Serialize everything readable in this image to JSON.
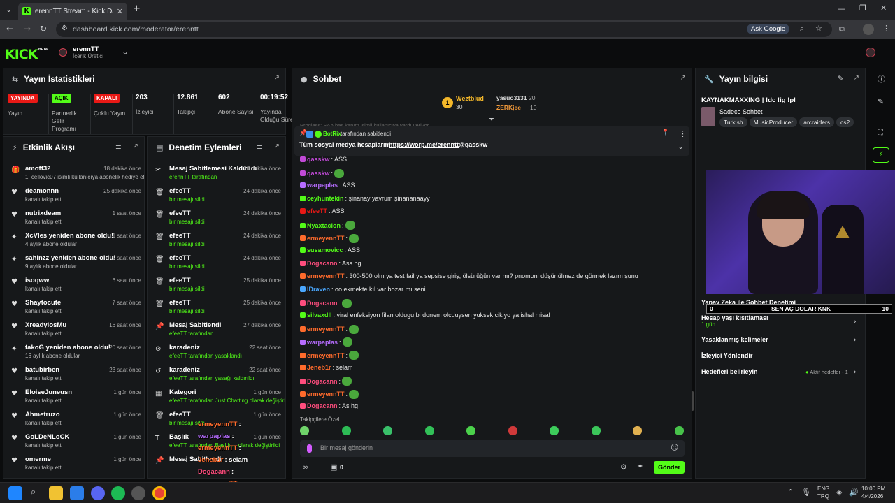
{
  "browser": {
    "tab_title": "erennTT Stream - Kick Dashboa",
    "url": "dashboard.kick.com/moderator/erenntt",
    "ask_google": "Ask Google"
  },
  "header": {
    "logo": "KICK",
    "beta": "BETA",
    "channel": "erennTT",
    "role": "İçerik Üretici"
  },
  "stats": {
    "title": "Yayın İstatistikleri",
    "items": [
      {
        "badge": "YAYINDA",
        "badge_color": "#e91916",
        "label": "Yayın"
      },
      {
        "badge": "AÇIK",
        "badge_color": "#53fc18",
        "label": "Partnerlik Gelir Programı"
      },
      {
        "badge": "KAPALI",
        "badge_color": "#e91916",
        "label": "Çoklu Yayın"
      },
      {
        "value": "203",
        "label": "İzleyici"
      },
      {
        "value": "12.861",
        "label": "Takipçi"
      },
      {
        "value": "602",
        "label": "Abone Sayısı"
      },
      {
        "value": "00:19:52",
        "label": "Yayında Olduğu Süre"
      }
    ]
  },
  "activity": {
    "title": "Etkinlik Akışı",
    "items": [
      {
        "icon": "gift-icon",
        "name": "amoff32",
        "sub": "1, cellovic07 isimli kullanıcıya abonelik hediye etti.",
        "time": "18 dakika önce"
      },
      {
        "icon": "heart-icon",
        "name": "deamonnn",
        "sub": "kanalı takip etti",
        "time": "25 dakika önce"
      },
      {
        "icon": "heart-icon",
        "name": "nutrixdeam",
        "sub": "kanalı takip etti",
        "time": "1 saat önce"
      },
      {
        "icon": "star-icon",
        "name": "XcVles yeniden abone oldu!",
        "sub": "4 aylık abone oldular",
        "time": "1 saat önce"
      },
      {
        "icon": "star-icon",
        "name": "sahinzz yeniden abone oldu!",
        "sub": "9 aylık abone oldular",
        "time": "1 saat önce"
      },
      {
        "icon": "heart-icon",
        "name": "isoqww",
        "sub": "kanalı takip etti",
        "time": "6 saat önce"
      },
      {
        "icon": "heart-icon",
        "name": "Shaytocute",
        "sub": "kanalı takip etti",
        "time": "7 saat önce"
      },
      {
        "icon": "heart-icon",
        "name": "XreadylosMu",
        "sub": "kanalı takip etti",
        "time": "16 saat önce"
      },
      {
        "icon": "star-icon",
        "name": "takoG yeniden abone oldu!",
        "sub": "16 aylık abone oldular",
        "time": "20 saat önce"
      },
      {
        "icon": "heart-icon",
        "name": "batubirben",
        "sub": "kanalı takip etti",
        "time": "23 saat önce"
      },
      {
        "icon": "heart-icon",
        "name": "EloiseJuneusn",
        "sub": "kanalı takip etti",
        "time": "1 gün önce"
      },
      {
        "icon": "heart-icon",
        "name": "Ahmetruzo",
        "sub": "kanalı takip etti",
        "time": "1 gün önce"
      },
      {
        "icon": "heart-icon",
        "name": "GoLDeNLoCK",
        "sub": "kanalı takip etti",
        "time": "1 gün önce"
      },
      {
        "icon": "heart-icon",
        "name": "omerme",
        "sub": "kanalı takip etti",
        "time": "1 gün önce"
      }
    ]
  },
  "mod": {
    "title": "Denetim Eylemleri",
    "items": [
      {
        "icon": "unpin-icon",
        "name": "Mesaj Sabitlemesi Kaldırıldı",
        "sub": "erennTT tarafından",
        "time": "20 dakika önce"
      },
      {
        "icon": "trash-icon",
        "name": "efeeTT",
        "sub": "bir mesajı sildi",
        "time": "24 dakika önce"
      },
      {
        "icon": "trash-icon",
        "name": "efeeTT",
        "sub": "bir mesajı sildi",
        "time": "24 dakika önce"
      },
      {
        "icon": "trash-icon",
        "name": "efeeTT",
        "sub": "bir mesajı sildi",
        "time": "24 dakika önce"
      },
      {
        "icon": "trash-icon",
        "name": "efeeTT",
        "sub": "bir mesajı sildi",
        "time": "24 dakika önce"
      },
      {
        "icon": "trash-icon",
        "name": "efeeTT",
        "sub": "bir mesajı sildi",
        "time": "25 dakika önce"
      },
      {
        "icon": "trash-icon",
        "name": "efeeTT",
        "sub": "bir mesajı sildi",
        "time": "25 dakika önce"
      },
      {
        "icon": "pin-icon",
        "name": "Mesaj Sabitlendi",
        "sub": "efeeTT tarafından",
        "time": "27 dakika önce"
      },
      {
        "icon": "ban-icon",
        "name": "karadeniz",
        "sub": "efeeTT tarafından yasaklandı",
        "time": "22 saat önce"
      },
      {
        "icon": "undo-icon",
        "name": "karadeniz",
        "sub": "efeeTT tarafından yasağı kaldırıldı",
        "time": "22 saat önce"
      },
      {
        "icon": "category-icon",
        "name": "Kategori",
        "sub": "efeeTT tarafından Just Chatting olarak değiştirildi",
        "time": "1 gün önce"
      },
      {
        "icon": "trash-icon",
        "name": "efeeTT",
        "sub": "bir mesajı sildi",
        "time": "1 gün önce"
      },
      {
        "icon": "title-icon",
        "name": "Başlık",
        "sub": "efeeTT tarafından Başlık ... olarak değiştirildi",
        "time": "1 gün önce"
      },
      {
        "icon": "pin-icon",
        "name": "Mesaj Sabitlendi",
        "sub": "",
        "time": ""
      }
    ]
  },
  "chat": {
    "title": "Sohbet",
    "top": [
      {
        "name": "Weztblud",
        "count": "30"
      },
      {
        "name": "yasuo3131",
        "count": "20"
      },
      {
        "name": "ZERKjee",
        "count": "10"
      }
    ],
    "faded": "Progless: SAA has kanım isimli kullanıcıya vardı veriyor",
    "pinned_by": "BotRix",
    "pinned_by_suffix": "tarafından sabitlendi",
    "pinned_text": "Tüm sosyal medya hesaplarım:",
    "pinned_link": "https://worp.me/erenntt",
    "pinned_tag": "@qasskw",
    "messages": [
      {
        "user": "qasskw",
        "color": "#c24ad8",
        "text": ": ASS"
      },
      {
        "user": "qasskw",
        "color": "#c24ad8",
        "text": ":"
      },
      {
        "user": "warpaplas",
        "color": "#b66cff",
        "text": ": ASS"
      },
      {
        "user": "ceyhuntekin",
        "color": "#53fc18",
        "text": ": şinanay yavrum şinananaayy"
      },
      {
        "user": "efeeTT",
        "color": "#e91916",
        "text": ": ASS"
      },
      {
        "user": "Nyaxtacion",
        "color": "#53fc18",
        "text": ":"
      },
      {
        "user": "ermeyennTT",
        "color": "#ff6b2c",
        "text": ":"
      },
      {
        "user": "susamovicc",
        "color": "#53fc18",
        "text": ": ASS"
      },
      {
        "user": "Dogacann",
        "color": "#ff4d7e",
        "text": ": Ass hg"
      },
      {
        "user": "ermeyennTT",
        "color": "#ff6b2c",
        "text": ": 300-500 olm ya test fail ya sepsise giriş, ölsürüğün var mı? pnomoni düşünülmez de görmek lazım şunu"
      },
      {
        "user": "IDraven",
        "color": "#4aa8ff",
        "text": ": oo ekmekte kıl var bozar mı seni"
      },
      {
        "user": "Dogacann",
        "color": "#ff4d7e",
        "text": ":"
      },
      {
        "user": "silvaxdll",
        "color": "#53fc18",
        "text": ": viral enfeksiyon filan oldugu bi donem olcduysen yuksek cikiyo ya ishal misal"
      },
      {
        "user": "ermeyennTT",
        "color": "#ff6b2c",
        "text": ":"
      },
      {
        "user": "warpaplas",
        "color": "#b66cff",
        "text": ":"
      },
      {
        "user": "ermeyennTT",
        "color": "#ff6b2c",
        "text": ":"
      },
      {
        "user": "Jeneb1r",
        "color": "#ff6b2c",
        "text": ": selam"
      },
      {
        "user": "Dogacann",
        "color": "#ff4d7e",
        "text": ":"
      },
      {
        "user": "ermeyennTT",
        "color": "#ff6b2c",
        "text": ":"
      },
      {
        "user": "Dogacann",
        "color": "#ff4d7e",
        "text": ": As hg"
      }
    ],
    "followers_only": "Takipçilere Özel",
    "placeholder": "Bir mesaj gönderin",
    "count": "0",
    "send": "Gönder"
  },
  "info": {
    "title": "Yayın bilgisi",
    "stream_title": "KAYNAKMAXXING | !dc !ig !pl",
    "category": "Sadece Sohbet",
    "tags": [
      "Turkish",
      "MusicProducer",
      "arcraiders",
      "cs2"
    ]
  },
  "settings": {
    "ai_mod": "Yapay Zeka ile Sohbet Denetimi",
    "age": "Hesap yaşı kısıtlaması",
    "age_value": "1 gün",
    "banned_words": "Yasaklanmış kelimeler",
    "redirect": "İzleyici Yönlendir",
    "goals": "Hedefleri belirleyin",
    "goals_status": "Aktif hedefler - 1"
  },
  "goal_bar": {
    "min": "0",
    "label": "SEN AÇ DOLAR KNK",
    "max": "10"
  },
  "overlay_chat": [
    {
      "user": "ermeyennTT",
      "color": "#ff6b2c",
      "text": ":"
    },
    {
      "user": "warpaplas",
      "color": "#b66cff",
      "text": ":"
    },
    {
      "user": "ermeyennTT",
      "color": "#ff6b2c",
      "text": ":"
    },
    {
      "user": "Jeneb1r",
      "color": "#ff6b2c",
      "text": ": selam"
    },
    {
      "user": "Dogacann",
      "color": "#ff4d7e",
      "text": ":"
    },
    {
      "user": "ermeyennTT",
      "color": "#ff6b2c",
      "text": ":"
    },
    {
      "user": "Dogacann",
      "color": "#ff4d7e",
      "text": ": As hg"
    }
  ],
  "taskbar": {
    "lang1": "ENG",
    "lang2": "TRQ",
    "time": "10:00 PM",
    "date": "4/4/2026"
  }
}
